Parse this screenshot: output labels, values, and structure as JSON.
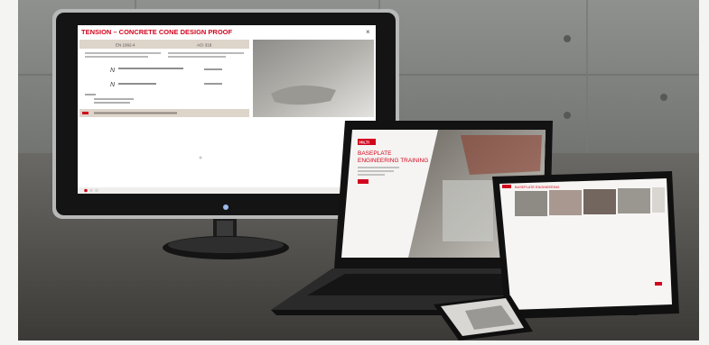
{
  "monitor": {
    "title": "TENSION – CONCRETE CONE DESIGN PROOF",
    "close_glyph": "×",
    "table_headers": [
      "EN 1992-4",
      "ACI 318"
    ],
    "note_text": "TENSION – CONCRETE CONE DESIGN PROOF",
    "formula_left": "N",
    "formula_right": "N"
  },
  "laptop": {
    "brand": "HILTI",
    "headline": "BASEPLATE\nENGINEERING TRAINING"
  },
  "tablet": {
    "header": "BASEPLATE ENGINEERING"
  },
  "colors": {
    "accent": "#d2051e",
    "wall": "#8a8c8a",
    "floor": "#5a5855",
    "bezel": "#141414"
  }
}
